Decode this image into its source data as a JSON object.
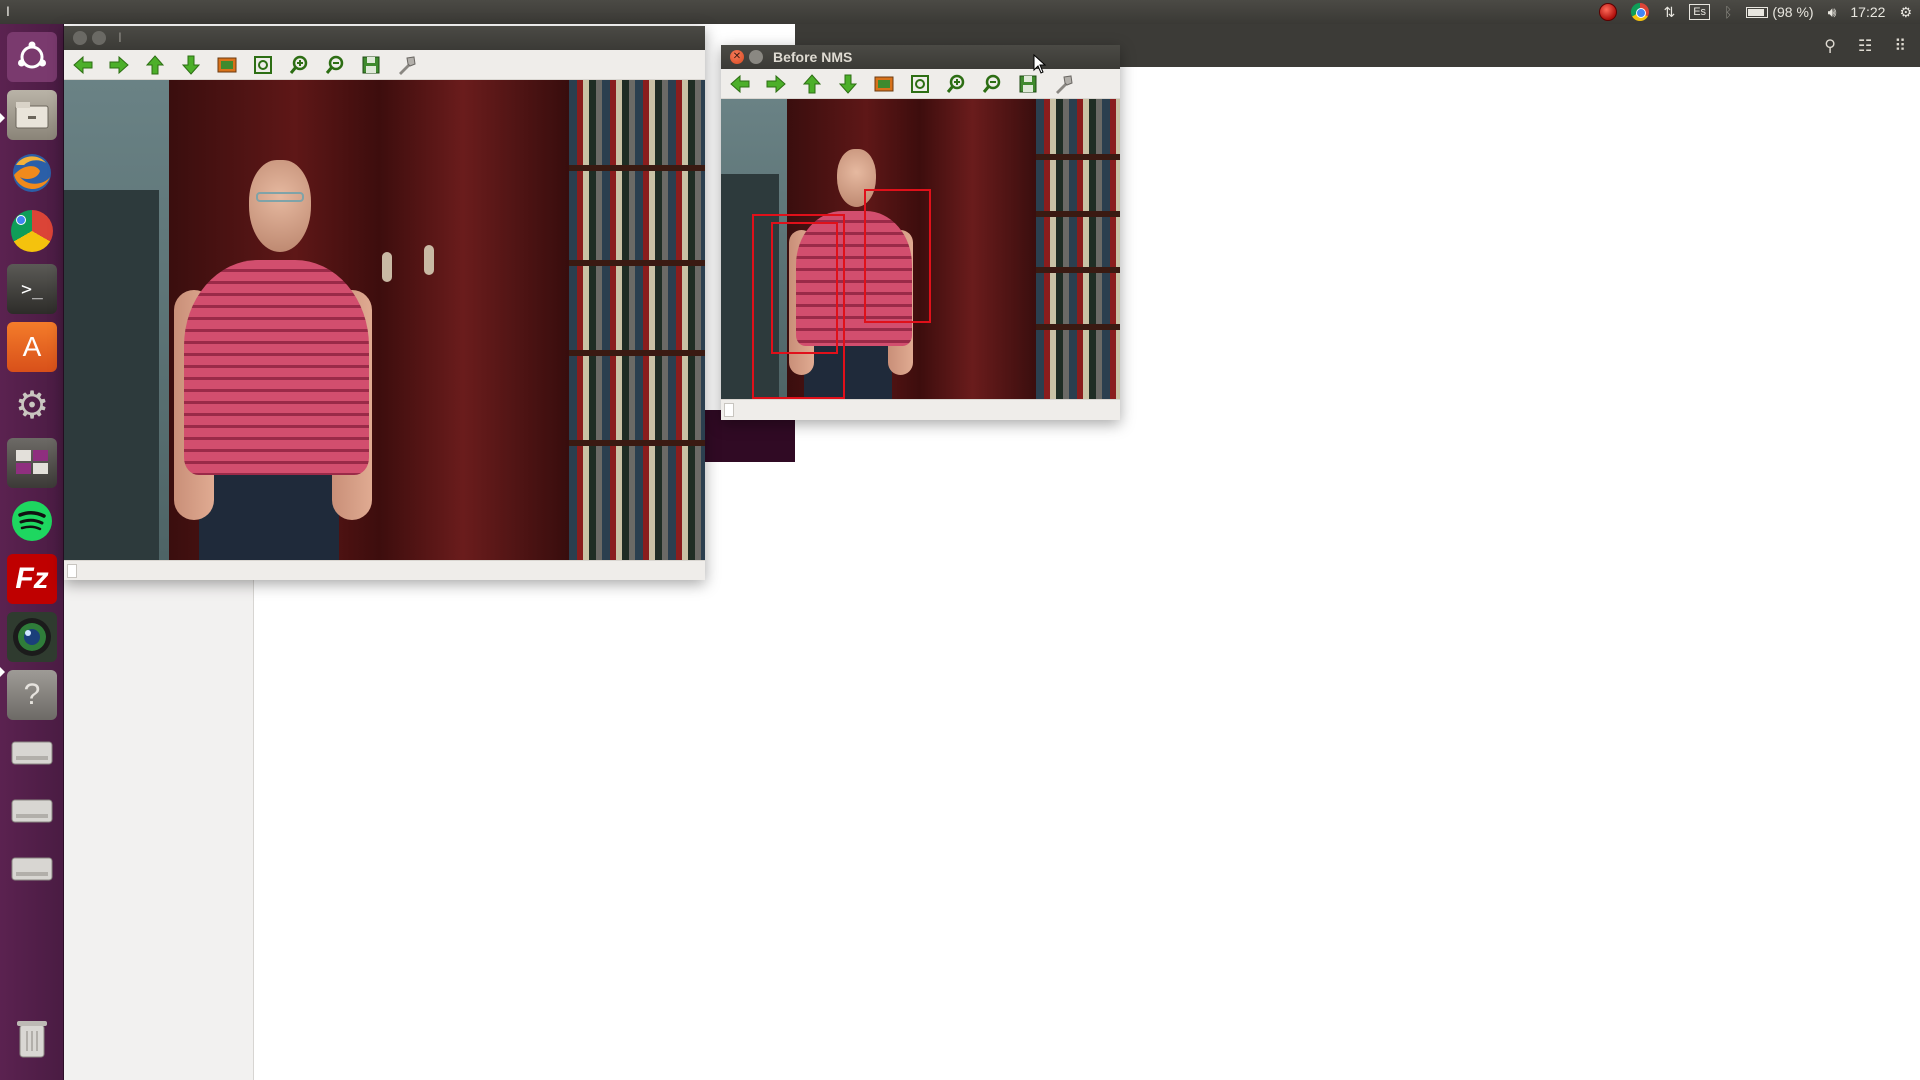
{
  "topbar": {
    "app_indicator": "I",
    "tray": {
      "keyboard_layout": "Es",
      "battery_text": "(98 %)",
      "clock": "17:22"
    }
  },
  "launcher": {
    "items": [
      {
        "name": "ubuntu-home-icon"
      },
      {
        "name": "files-icon"
      },
      {
        "name": "firefox-icon"
      },
      {
        "name": "chrome-icon"
      },
      {
        "name": "terminal-icon"
      },
      {
        "name": "software-center-icon"
      },
      {
        "name": "system-settings-icon"
      },
      {
        "name": "workspace-switcher-icon"
      },
      {
        "name": "spotify-icon"
      },
      {
        "name": "filezilla-icon"
      },
      {
        "name": "cheese-webcam-icon"
      },
      {
        "name": "help-icon"
      },
      {
        "name": "drive-icon"
      },
      {
        "name": "drive-icon"
      },
      {
        "name": "drive-icon"
      },
      {
        "name": "trash-icon"
      }
    ],
    "filezilla_label": "Fz",
    "help_label": "?"
  },
  "window_main": {
    "title": "",
    "title_indicator": "I"
  },
  "window_nms": {
    "title": "Before NMS"
  },
  "toolbar_icons": [
    "arrow-left-icon",
    "arrow-right-icon",
    "arrow-up-icon",
    "arrow-down-icon",
    "image-icon",
    "zoom-fit-icon",
    "zoom-in-icon",
    "zoom-out-icon",
    "save-icon",
    "properties-icon"
  ]
}
